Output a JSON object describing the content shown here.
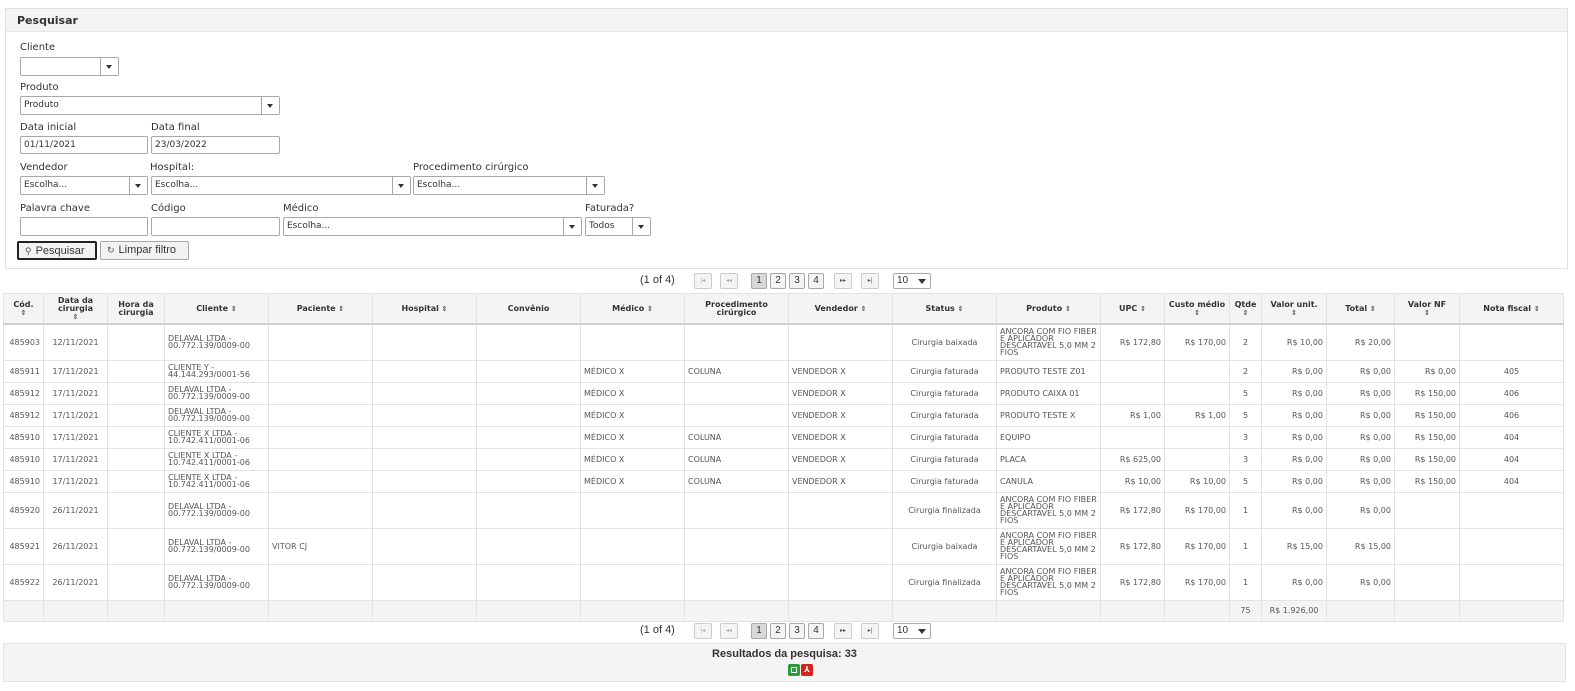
{
  "search": {
    "title": "Pesquisar",
    "cliente_label": "Cliente",
    "cliente_value": "",
    "produto_label": "Produto",
    "produto_value": "Produto",
    "data_inicial_label": "Data inicial",
    "data_inicial_value": "01/11/2021",
    "data_final_label": "Data final",
    "data_final_value": "23/03/2022",
    "vendedor_label": "Vendedor",
    "vendedor_value": "Escolha...",
    "hospital_label": "Hospital:",
    "hospital_value": "Escolha...",
    "procedimento_label": "Procedimento cirúrgico",
    "procedimento_value": "Escolha...",
    "palavra_label": "Palavra chave",
    "palavra_value": "",
    "codigo_label": "Código",
    "codigo_value": "",
    "medico_label": "Médico",
    "medico_value": "Escolha...",
    "faturada_label": "Faturada?",
    "faturada_value": "Todos",
    "pesquisar_button": "Pesquisar",
    "limpar_button": "Limpar filtro"
  },
  "pager": {
    "status": "(1 of 4)",
    "first": "|◂",
    "prev": "◂◂",
    "next": "▸▸",
    "last": "▸|",
    "pages": [
      "1",
      "2",
      "3",
      "4"
    ],
    "rows_per_page": "10"
  },
  "table": {
    "columns": [
      "Cód.",
      "Data da cirurgia",
      "Hora da cirurgia",
      "Cliente",
      "Paciente",
      "Hospital",
      "Convênio",
      "Médico",
      "Procedimento cirúrgico",
      "Vendedor",
      "Status",
      "Produto",
      "UPC",
      "Custo médio",
      "Qtde",
      "Valor unit.",
      "Total",
      "Valor NF",
      "Nota fiscal"
    ],
    "rows": [
      [
        "485903",
        "12/11/2021",
        "",
        "DELAVAL LTDA - 00.772.139/0009-00",
        "",
        "",
        "",
        "",
        "",
        "",
        "Cirurgia baixada",
        "ANCORA COM FIO FIBER E APLICADOR DESCARTAVEL 5,0 MM 2 FIOS",
        "R$ 172,80",
        "R$ 170,00",
        "2",
        "R$ 10,00",
        "R$ 20,00",
        "",
        ""
      ],
      [
        "485911",
        "17/11/2021",
        "",
        "CLIENTE Y - 44.144.293/0001-56",
        "",
        "",
        "",
        "MÉDICO X",
        "COLUNA",
        "VENDEDOR X",
        "Cirurgia faturada",
        "PRODUTO TESTE Z01",
        "",
        "",
        "2",
        "R$ 0,00",
        "R$ 0,00",
        "R$ 0,00",
        "405"
      ],
      [
        "485912",
        "17/11/2021",
        "",
        "DELAVAL LTDA - 00.772.139/0009-00",
        "",
        "",
        "",
        "MÉDICO X",
        "",
        "VENDEDOR X",
        "Cirurgia faturada",
        "PRODUTO CAIXA 01",
        "",
        "",
        "5",
        "R$ 0,00",
        "R$ 0,00",
        "R$ 150,00",
        "406"
      ],
      [
        "485912",
        "17/11/2021",
        "",
        "DELAVAL LTDA - 00.772.139/0009-00",
        "",
        "",
        "",
        "MÉDICO X",
        "",
        "VENDEDOR X",
        "Cirurgia faturada",
        "PRODUTO TESTE X",
        "R$ 1,00",
        "R$ 1,00",
        "5",
        "R$ 0,00",
        "R$ 0,00",
        "R$ 150,00",
        "406"
      ],
      [
        "485910",
        "17/11/2021",
        "",
        "CLIENTE X LTDA - 10.742.411/0001-06",
        "",
        "",
        "",
        "MÉDICO X",
        "COLUNA",
        "VENDEDOR X",
        "Cirurgia faturada",
        "EQUIPO",
        "",
        "",
        "3",
        "R$ 0,00",
        "R$ 0,00",
        "R$ 150,00",
        "404"
      ],
      [
        "485910",
        "17/11/2021",
        "",
        "CLIENTE X LTDA - 10.742.411/0001-06",
        "",
        "",
        "",
        "MÉDICO X",
        "COLUNA",
        "VENDEDOR X",
        "Cirurgia faturada",
        "PLACA",
        "R$ 625,00",
        "",
        "3",
        "R$ 0,00",
        "R$ 0,00",
        "R$ 150,00",
        "404"
      ],
      [
        "485910",
        "17/11/2021",
        "",
        "CLIENTE X LTDA - 10.742.411/0001-06",
        "",
        "",
        "",
        "MÉDICO X",
        "COLUNA",
        "VENDEDOR X",
        "Cirurgia faturada",
        "CANULA",
        "R$ 10,00",
        "R$ 10,00",
        "5",
        "R$ 0,00",
        "R$ 0,00",
        "R$ 150,00",
        "404"
      ],
      [
        "485920",
        "26/11/2021",
        "",
        "DELAVAL LTDA - 00.772.139/0009-00",
        "",
        "",
        "",
        "",
        "",
        "",
        "Cirurgia finalizada",
        "ANCORA COM FIO FIBER E APLICADOR DESCARTAVEL 5,0 MM 2 FIOS",
        "R$ 172,80",
        "R$ 170,00",
        "1",
        "R$ 0,00",
        "R$ 0,00",
        "",
        ""
      ],
      [
        "485921",
        "26/11/2021",
        "",
        "DELAVAL LTDA - 00.772.139/0009-00",
        "VITOR CJ",
        "",
        "",
        "",
        "",
        "",
        "Cirurgia baixada",
        "ANCORA COM FIO FIBER E APLICADOR DESCARTAVEL 5,0 MM 2 FIOS",
        "R$ 172,80",
        "R$ 170,00",
        "1",
        "R$ 15,00",
        "R$ 15,00",
        "",
        ""
      ],
      [
        "485922",
        "26/11/2021",
        "",
        "DELAVAL LTDA - 00.772.139/0009-00",
        "",
        "",
        "",
        "",
        "",
        "",
        "Cirurgia finalizada",
        "ANCORA COM FIO FIBER E APLICADOR DESCARTAVEL 5,0 MM 2 FIOS",
        "R$ 172,80",
        "R$ 170,00",
        "1",
        "R$ 0,00",
        "R$ 0,00",
        "",
        ""
      ]
    ],
    "footer": {
      "qtde_total": "75",
      "valor_unit_total": "R$ 1.926,00"
    }
  },
  "summary": {
    "results_text": "Resultados da pesquisa: 33",
    "excel_icon": "excel-export-icon",
    "pdf_icon": "pdf-export-icon",
    "pdf_glyph": "⅄"
  }
}
